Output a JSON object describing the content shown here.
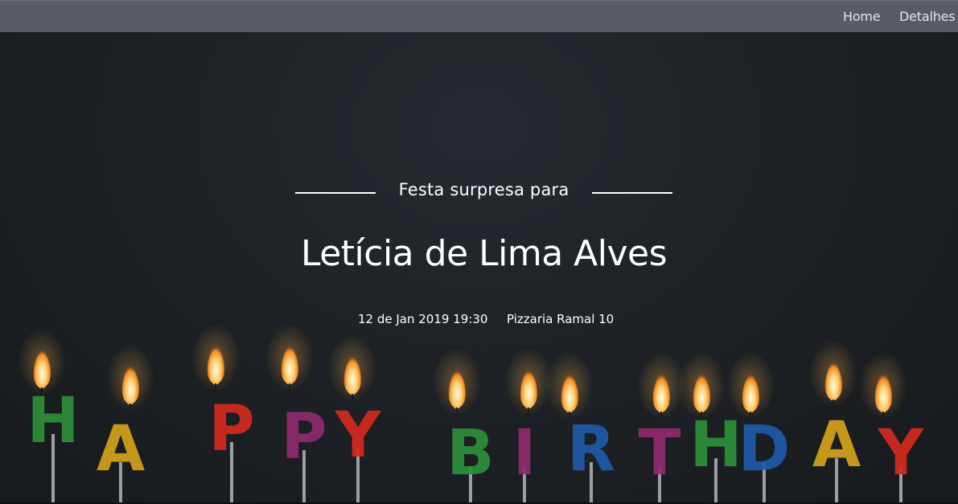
{
  "nav": {
    "home_label": "Home",
    "details_label": "Detalhes"
  },
  "hero": {
    "subtitle": "Festa surpresa para",
    "name": "Letícia de Lima Alves",
    "date": "12 de Jan 2019 19:30",
    "place": "Pizzaria Ramal 10",
    "background_image": "happy-birthday-candles",
    "candle_letters": [
      "H",
      "A",
      "P",
      "P",
      "Y",
      "B",
      "I",
      "R",
      "T",
      "H",
      "D",
      "A",
      "Y"
    ]
  },
  "colors": {
    "navbar": "#585c63",
    "background": "#1b1e21",
    "text": "#ffffff"
  }
}
